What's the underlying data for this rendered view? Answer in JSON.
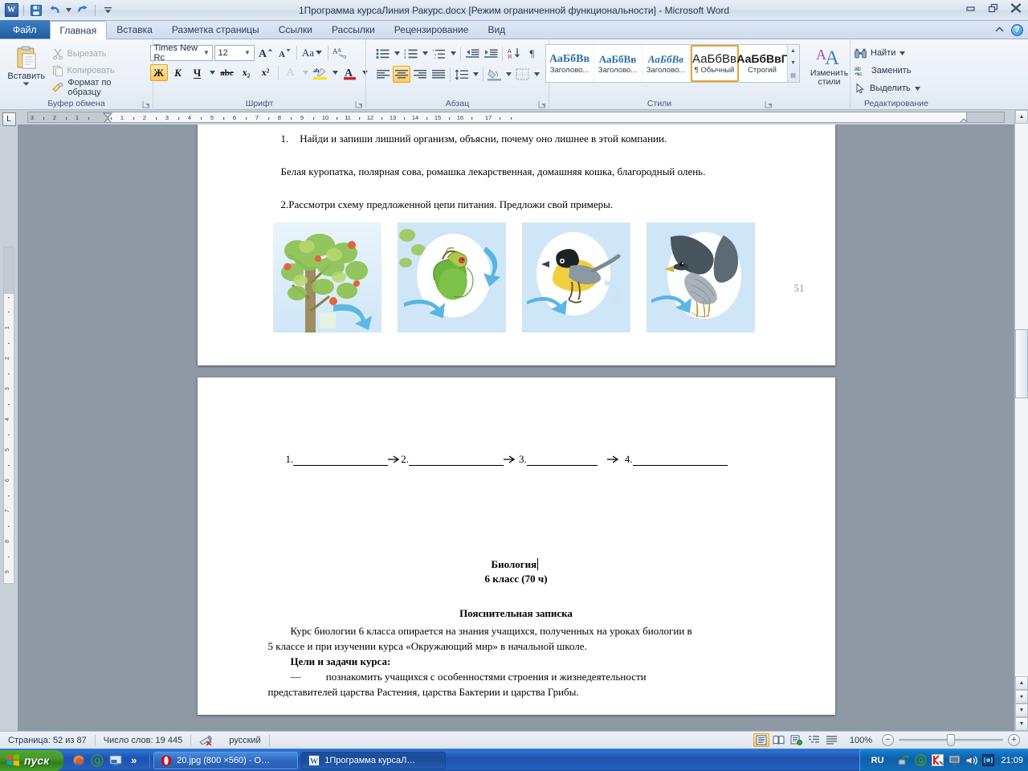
{
  "titlebar": {
    "document_title": "1Программа курсаЛиния Ракурс.docx [Режим ограниченной функциональности]  -  Microsoft Word",
    "qat": [
      {
        "name": "word-logo-icon",
        "label": "W"
      },
      {
        "name": "save-icon",
        "label": "save"
      },
      {
        "name": "undo-icon",
        "label": "undo"
      },
      {
        "name": "redo-icon",
        "label": "redo"
      },
      {
        "name": "customize-qat-icon",
        "label": "customize"
      }
    ],
    "window_controls": {
      "minimize": "minimize",
      "restore": "restore",
      "close": "close"
    },
    "ribbon_collapse": "collapse-ribbon",
    "help": "?"
  },
  "tabs": [
    {
      "label": "Файл",
      "kind": "file"
    },
    {
      "label": "Главная",
      "kind": "active"
    },
    {
      "label": "Вставка",
      "kind": "normal"
    },
    {
      "label": "Разметка страницы",
      "kind": "normal"
    },
    {
      "label": "Ссылки",
      "kind": "normal"
    },
    {
      "label": "Рассылки",
      "kind": "normal"
    },
    {
      "label": "Рецензирование",
      "kind": "normal"
    },
    {
      "label": "Вид",
      "kind": "normal"
    }
  ],
  "ribbon": {
    "clipboard": {
      "group_label": "Буфер обмена",
      "paste_label": "Вставить",
      "items": [
        {
          "label": "Вырезать",
          "icon": "scissors-icon",
          "disabled": true
        },
        {
          "label": "Копировать",
          "icon": "copy-icon",
          "disabled": true
        },
        {
          "label": "Формат по образцу",
          "icon": "format-painter-icon",
          "disabled": false
        }
      ]
    },
    "font": {
      "group_label": "Шрифт",
      "font_name": "Times New Rc",
      "font_size": "12",
      "grow_font": "A",
      "shrink_font": "A",
      "change_case": "Aa",
      "clear_format": "clear-formatting",
      "bold": "Ж",
      "italic": "К",
      "underline": "Ч",
      "strikethrough": "abc",
      "subscript": "x₂",
      "superscript": "x²",
      "text_effects": "A",
      "highlight": "ab",
      "font_color": "A"
    },
    "paragraph": {
      "group_label": "Абзац",
      "bullets": "bullet-list",
      "numbering": "numbered-list",
      "multilevel": "multilevel-list",
      "decrease_indent": "decrease-indent",
      "increase_indent": "increase-indent",
      "sort": "sort",
      "show_marks": "¶",
      "align_left": "align-left",
      "align_center": "align-center",
      "align_right": "align-right",
      "justify": "justify",
      "line_spacing": "line-spacing",
      "shading": "shading",
      "borders": "borders"
    },
    "styles": {
      "group_label": "Стили",
      "gallery": [
        {
          "sample": "АаБбВв",
          "name": "Заголово...",
          "selected": false,
          "style": "h1"
        },
        {
          "sample": "АаБбВв",
          "name": "Заголово...",
          "selected": false,
          "style": "h2"
        },
        {
          "sample": "АаБбВв",
          "name": "Заголово...",
          "selected": false,
          "style": "h3"
        },
        {
          "sample": "АаБбВв",
          "name": "¶ Обычный",
          "selected": true,
          "style": "normal"
        },
        {
          "sample": "АаБбВвГ",
          "name": "Строгий",
          "selected": false,
          "style": "strong"
        }
      ],
      "change_styles": "Изменить стили"
    },
    "editing": {
      "group_label": "Редактирование",
      "items": [
        {
          "label": "Найти",
          "icon": "binoculars-icon",
          "dropdown": true
        },
        {
          "label": "Заменить",
          "icon": "replace-icon",
          "dropdown": false
        },
        {
          "label": "Выделить",
          "icon": "select-arrow-icon",
          "dropdown": true
        }
      ]
    }
  },
  "ruler": {
    "tab_selector": "L",
    "h_numbers": [
      "3",
      "2",
      "1",
      "1",
      "2",
      "3",
      "4",
      "5",
      "6",
      "7",
      "8",
      "9",
      "10",
      "11",
      "12",
      "13",
      "14",
      "15",
      "16",
      "17"
    ],
    "v_numbers": [
      "2",
      "1",
      "1",
      "2",
      "3",
      "4",
      "5",
      "6",
      "7",
      "8",
      "9"
    ]
  },
  "document": {
    "page1": {
      "task1_number": "1.",
      "task1_text": "Найди и запиши лишний организм, объясни, почему оно лишнее в этой компании.",
      "organisms": "Белая куропатка, полярная сова, ромашка лекарственная, домашняя кошка, благородный олень.",
      "task2_text": "2.Рассмотри схему предложенной цепи питания. Предложи свой примеры.",
      "page_number": "51",
      "images": [
        {
          "name": "apple-tree-image",
          "alt": "Яблоня"
        },
        {
          "name": "caterpillar-leaves-image",
          "alt": "Гусеница на листьях"
        },
        {
          "name": "tit-bird-image",
          "alt": "Синица"
        },
        {
          "name": "falcon-image",
          "alt": "Сокол"
        }
      ]
    },
    "page2": {
      "chain_blanks": [
        "1.",
        "2.",
        "3.",
        "4."
      ],
      "title": "Биология",
      "subtitle": "6 класс (70 ч)",
      "section_heading": "Пояснительная записка",
      "para1_line1": "Курс биологии 6 класса опирается на знания учащихся, полученных на уроках биологии в",
      "para1_line2": "5 классе и при изучении курса «Окружающий мир» в начальной школе.",
      "goals_heading": "Цели и задачи курса:",
      "goal_dash": "—",
      "goal_line1": "познакомить учащихся с особенностями строения и жизнедеятельности",
      "goal_line2": "представителей царства Растения, царства Бактерии и царства Грибы."
    }
  },
  "statusbar": {
    "page_info": "Страница: 52 из 87",
    "word_count": "Число слов: 19 445",
    "proofing_icon": "spellcheck-error-icon",
    "language": "русский",
    "views": [
      {
        "name": "print-layout-view",
        "selected": true
      },
      {
        "name": "full-screen-reading-view",
        "selected": false
      },
      {
        "name": "web-layout-view",
        "selected": false
      },
      {
        "name": "outline-view",
        "selected": false
      },
      {
        "name": "draft-view",
        "selected": false
      }
    ],
    "zoom_level": "100%",
    "zoom_out": "−",
    "zoom_in": "+"
  },
  "taskbar": {
    "start_label": "пуск",
    "quick_launch": [
      {
        "name": "firefox-icon"
      },
      {
        "name": "opera-icon"
      },
      {
        "name": "show-desktop-icon"
      },
      {
        "name": "more-chevron-icon",
        "label": "»"
      }
    ],
    "items": [
      {
        "label": "20.jpg (800 ×560) - O…",
        "icon": "opera-icon",
        "active": false
      },
      {
        "label": "1Программа курсаЛ…",
        "icon": "word-icon",
        "active": true
      }
    ],
    "tray": {
      "language": "RU",
      "icons": [
        {
          "name": "network-icon"
        },
        {
          "name": "opera-mail-icon"
        },
        {
          "name": "kaspersky-icon"
        },
        {
          "name": "monitor-icon"
        },
        {
          "name": "volume-icon"
        },
        {
          "name": "wifi-icon"
        }
      ],
      "clock": "21:09"
    }
  },
  "colors": {
    "accent": "#2f6fd0",
    "ribbon_highlight": "#ffc95e",
    "word_blue": "#2c5d9b"
  }
}
